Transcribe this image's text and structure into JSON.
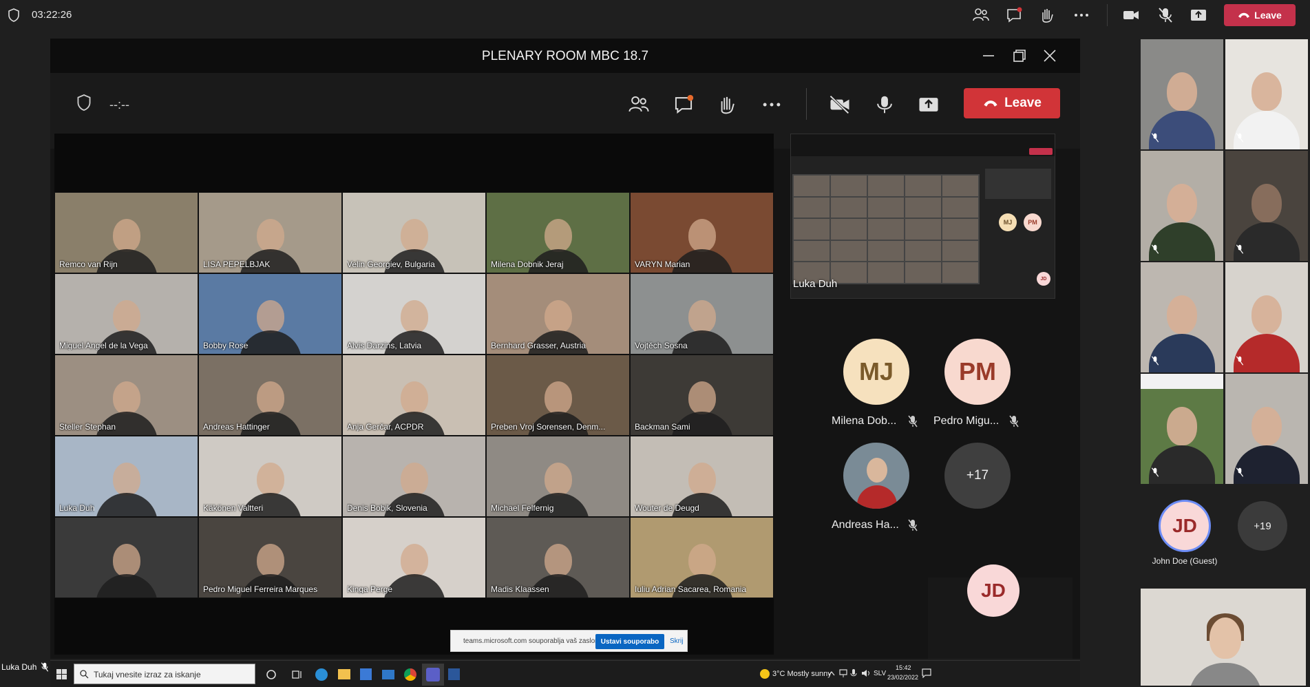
{
  "topbar": {
    "timer": "03:22:26",
    "leave_label": "Leave"
  },
  "shared_window": {
    "title": "PLENARY ROOM MBC 18.7",
    "timer": "--:--",
    "leave_label": "Leave"
  },
  "gallery": {
    "participants": [
      {
        "name": "Remco van Rijn",
        "bg": "#8a7f6a"
      },
      {
        "name": "LISA PEPELBJAK",
        "bg": "#a59a8a"
      },
      {
        "name": "Velin Georgiev, Bulgaria",
        "bg": "#c7c2b8"
      },
      {
        "name": "Milena Dobnik Jeraj",
        "bg": "#5e6f45"
      },
      {
        "name": "VARYN Marian",
        "bg": "#7a4a32"
      },
      {
        "name": "Miguel Angel de la Vega",
        "bg": "#b5b1ac"
      },
      {
        "name": "Bobby Rose",
        "bg": "#5a7aa3"
      },
      {
        "name": "Alvis Darzins, Latvia",
        "bg": "#d4d2cf"
      },
      {
        "name": "Bernhard Grasser, Austria",
        "bg": "#a48d7a"
      },
      {
        "name": "Vojtěch Sosna",
        "bg": "#8d9090"
      },
      {
        "name": "Steller Stephan",
        "bg": "#9c8f82"
      },
      {
        "name": "Andreas Hattinger",
        "bg": "#7b7064"
      },
      {
        "name": "Anja Gerčar, ACPDR",
        "bg": "#c9bfb3"
      },
      {
        "name": "Preben Vroj Sorensen, Denm...",
        "bg": "#6b5a48"
      },
      {
        "name": "Backman Sami",
        "bg": "#3d3a36"
      },
      {
        "name": "Luka Duh",
        "bg": "#a8b6c6"
      },
      {
        "name": "Käkönen Valtteri",
        "bg": "#cfcac4"
      },
      {
        "name": "Denis Bobik, Slovenia",
        "bg": "#b8b3ae"
      },
      {
        "name": "Michael Felfernig",
        "bg": "#8f8a84"
      },
      {
        "name": "Wouter de Deugd",
        "bg": "#c3bdb5"
      },
      {
        "name": "",
        "bg": "#3a3a3a"
      },
      {
        "name": "Pedro Miguel Ferreira Marques",
        "bg": "#4a4540"
      },
      {
        "name": "Kinga Perge",
        "bg": "#d6d0ca"
      },
      {
        "name": "Madis Klaassen",
        "bg": "#5e5a55"
      },
      {
        "name": "Iuliu Adrian Sacarea, Romania",
        "bg": "#b09a70"
      }
    ]
  },
  "share_banner": {
    "message": "teams.microsoft.com souporablja vaš zaslon.",
    "stop_label": "Ustavi souporabo",
    "hide_label": "Skrij"
  },
  "nested": {
    "self_name": "Luka Duh",
    "mini_avatars": [
      "MJ",
      "PM",
      "JD"
    ]
  },
  "avatar_panel": {
    "people": [
      {
        "initials": "MJ",
        "label": "Milena Dob...",
        "bg": "#f6e1be",
        "fg": "#7a5a2a"
      },
      {
        "initials": "PM",
        "label": "Pedro Migu...",
        "bg": "#f8d9cf",
        "fg": "#9a3b2a"
      }
    ],
    "andreas_label": "Andreas Ha...",
    "overflow": "+17",
    "jd_initials": "JD"
  },
  "taskbar": {
    "search_placeholder": "Tukaj vnesite izraz za iskanje",
    "weather": "3°C  Mostly sunny",
    "lang": "SLV",
    "time": "15:42",
    "date": "23/02/2022"
  },
  "right_panel": {
    "jd_initials": "JD",
    "jd_label": "John Doe (Guest)",
    "overflow": "+19"
  },
  "self_view": {
    "name": "Luka Duh"
  },
  "colors": {
    "leave": "#c4314b",
    "accent": "#6c8cf5"
  }
}
